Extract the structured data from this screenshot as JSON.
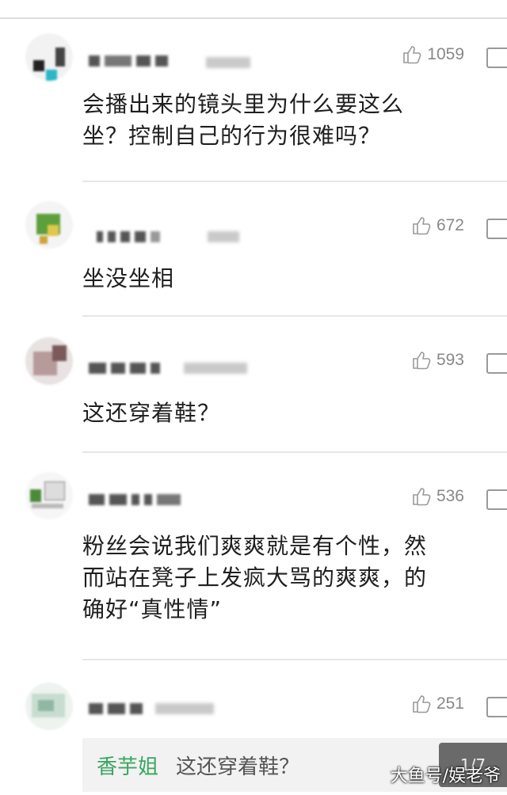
{
  "comments": [
    {
      "likes": "1059",
      "text_lines": [
        "会播出来的镜头里为什么要这么",
        "坐？控制自己的行为很难吗？"
      ]
    },
    {
      "likes": "672",
      "text_lines": [
        "坐没坐相"
      ]
    },
    {
      "likes": "593",
      "text_lines": [
        "这还穿着鞋？"
      ]
    },
    {
      "likes": "536",
      "text_lines": [
        "粉丝会说我们爽爽就是有个性，然",
        "而站在凳子上发疯大骂的爽爽，的",
        "确好“真性情”"
      ]
    },
    {
      "likes": "251",
      "text_lines": []
    }
  ],
  "reply_preview": {
    "user": "香芋姐",
    "text": "这还穿着鞋？",
    "page_indicator": "1/7"
  },
  "watermark": "大鱼号/娱老爷",
  "icons": {
    "like": "thumbs-up-icon",
    "reply": "comment-icon"
  },
  "colors": {
    "reply_user": "#3aa660",
    "like_text": "#888888",
    "reply_bg": "#f2f2f2"
  }
}
